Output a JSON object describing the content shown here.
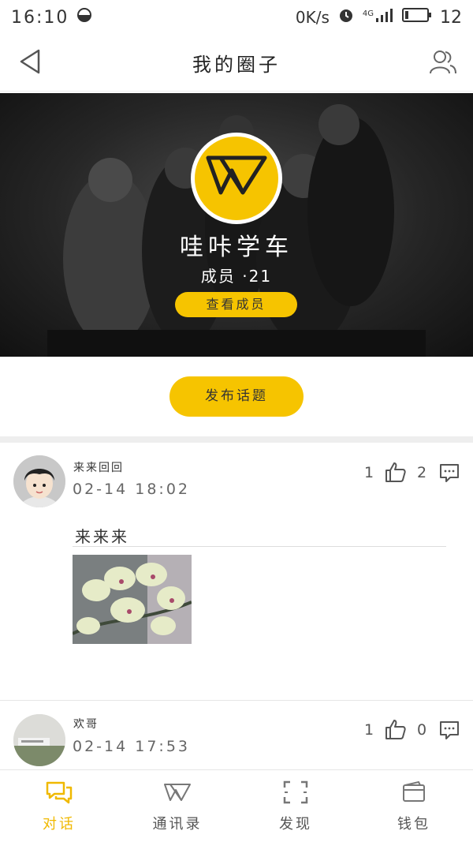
{
  "status_bar": {
    "time": "16:10",
    "net_speed": "0K/s",
    "network": "4G",
    "battery": "12"
  },
  "header": {
    "title": "我的圈子"
  },
  "banner": {
    "circle_name": "哇咔学车",
    "member_count": "成员 ·21",
    "view_members_label": "查看成员"
  },
  "actions": {
    "post_topic_label": "发布话题"
  },
  "feed": [
    {
      "username": "来来回回",
      "time": "02-14 18:02",
      "likes": "1",
      "comments": "2",
      "text": "来来来"
    },
    {
      "username": "欢哥",
      "time": "02-14 17:53",
      "likes": "1",
      "comments": "0"
    }
  ],
  "tabs": [
    {
      "label": "对话",
      "icon": "chat-icon",
      "active": true
    },
    {
      "label": "通讯录",
      "icon": "w-logo-icon",
      "active": false
    },
    {
      "label": "发现",
      "icon": "scan-icon",
      "active": false
    },
    {
      "label": "钱包",
      "icon": "wallet-icon",
      "active": false
    }
  ],
  "colors": {
    "accent": "#f6c400",
    "active_tab": "#f0b900",
    "banner_bg": "#262626"
  }
}
